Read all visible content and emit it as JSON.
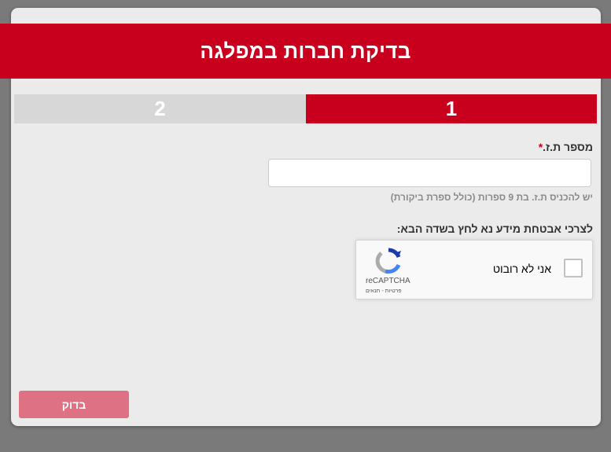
{
  "dialog": {
    "title": "בדיקת חברות במפלגה"
  },
  "steps": [
    {
      "number": "1",
      "active": true
    },
    {
      "number": "2",
      "active": false
    }
  ],
  "form": {
    "id_label": "מספר ת.ז.",
    "required_mark": "*",
    "id_value": "",
    "id_placeholder": "",
    "id_help": "יש להכניס ת.ז. בת 9 ספרות (כולל ספרת ביקורת)",
    "security_label": "לצרכי אבטחת מידע נא לחץ בשדה הבא:"
  },
  "recaptcha": {
    "label": "אני לא רובוט",
    "brand": "reCAPTCHA",
    "terms": "פרטיות - תנאים",
    "icon": "recaptcha-logo-icon"
  },
  "submit": {
    "label": "בדוק"
  },
  "colors": {
    "brand_red": "#c8001e",
    "inactive_step": "#d7d7d7",
    "submit_disabled": "#de7184",
    "background": "#ebebeb"
  }
}
